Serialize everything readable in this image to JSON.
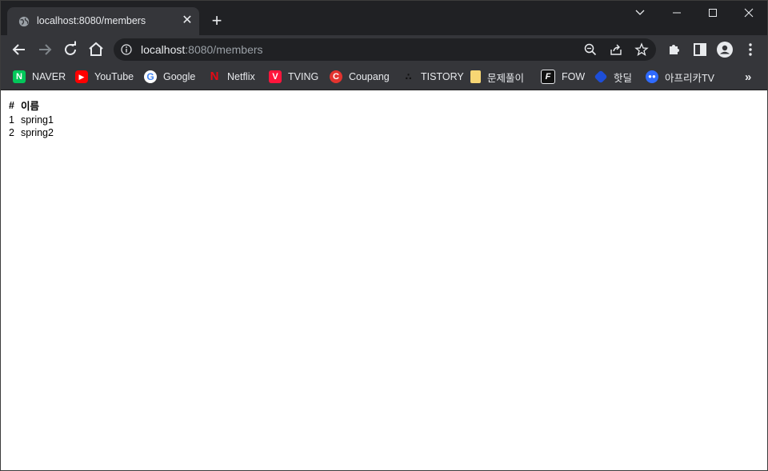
{
  "tab": {
    "title": "localhost:8080/members"
  },
  "address_bar": {
    "host": "localhost",
    "rest": ":8080/members"
  },
  "bookmarks": [
    {
      "label": "NAVER",
      "icon": "naver-icon",
      "color": "#03c75a"
    },
    {
      "label": "YouTube",
      "icon": "youtube-icon",
      "color": "#ff0000"
    },
    {
      "label": "Google",
      "icon": "google-icon",
      "color": "#4285f4"
    },
    {
      "label": "Netflix",
      "icon": "netflix-icon",
      "color": "#e50914"
    },
    {
      "label": "TVING",
      "icon": "tving-icon",
      "color": "#ff153c"
    },
    {
      "label": "Coupang",
      "icon": "coupang-icon",
      "color": "#e3342f"
    },
    {
      "label": "TISTORY",
      "icon": "tistory-icon",
      "color": "#000000"
    },
    {
      "label": "문제풀이",
      "icon": "folder-icon",
      "color": "#f7d674"
    },
    {
      "label": "FOW",
      "icon": "fow-icon",
      "color": "#111111"
    },
    {
      "label": "핫딜",
      "icon": "hotdeal-icon",
      "color": "#1d4ed8"
    },
    {
      "label": "아프리카TV",
      "icon": "afreecatv-icon",
      "color": "#2f6bff"
    }
  ],
  "bookmarks_overflow": "»",
  "table": {
    "headers": [
      "#",
      "이름"
    ],
    "rows": [
      [
        "1",
        "spring1"
      ],
      [
        "2",
        "spring2"
      ]
    ]
  }
}
